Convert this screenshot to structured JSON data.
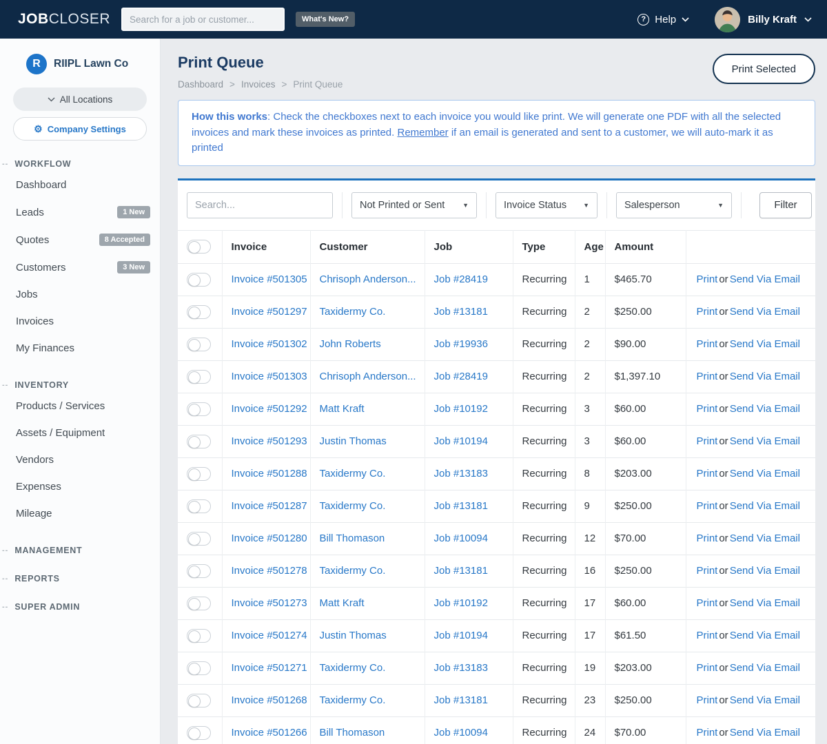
{
  "header": {
    "logo_bold": "JOB",
    "logo_light": "CLOSER",
    "search_placeholder": "Search for a job or customer...",
    "whats_new_label": "What's New?",
    "help_icon": "?",
    "help_label": "Help",
    "user_name": "Billy Kraft"
  },
  "sidebar": {
    "company_initial": "R",
    "company_name": "RIIPL Lawn Co",
    "locations_label": "All Locations",
    "settings_label": "Company Settings",
    "sections": [
      {
        "header": "WORKFLOW",
        "items": [
          {
            "label": "Dashboard"
          },
          {
            "label": "Leads",
            "badge": "1 New"
          },
          {
            "label": "Quotes",
            "badge": "8 Accepted"
          },
          {
            "label": "Customers",
            "badge": "3 New"
          },
          {
            "label": "Jobs"
          },
          {
            "label": "Invoices"
          },
          {
            "label": "My Finances"
          }
        ]
      },
      {
        "header": "INVENTORY",
        "items": [
          {
            "label": "Products / Services"
          },
          {
            "label": "Assets / Equipment"
          },
          {
            "label": "Vendors"
          },
          {
            "label": "Expenses"
          },
          {
            "label": "Mileage"
          }
        ]
      },
      {
        "header": "MANAGEMENT",
        "items": []
      },
      {
        "header": "REPORTS",
        "items": []
      },
      {
        "header": "SUPER ADMIN",
        "items": []
      }
    ]
  },
  "main": {
    "title": "Print Queue",
    "breadcrumb": [
      "Dashboard",
      "Invoices",
      "Print Queue"
    ],
    "breadcrumb_separator": ">",
    "print_selected_label": "Print Selected",
    "info": {
      "lead": "How this works",
      "body1": ": Check the checkboxes next to each invoice you would like print. We will generate one PDF with all the selected invoices and mark these invoices as printed. ",
      "remember": "Remember",
      "body2": " if an email is generated and sent to a customer, we will auto-mark it as printed"
    },
    "filters": {
      "search_placeholder": "Search...",
      "printed_filter_value": "Not Printed or Sent",
      "invoice_status_value": "Invoice Status",
      "salesperson_value": "Salesperson",
      "filter_button_label": "Filter"
    },
    "table": {
      "columns": [
        "Invoice",
        "Customer",
        "Job",
        "Type",
        "Age",
        "Amount"
      ],
      "actions": {
        "print": "Print",
        "or": "or",
        "email": "Send Via Email"
      },
      "rows": [
        {
          "invoice": "Invoice #501305",
          "customer": "Chrisoph Anderson...",
          "job": "Job #28419",
          "type": "Recurring",
          "age": "1",
          "amount": "$465.70"
        },
        {
          "invoice": "Invoice #501297",
          "customer": "Taxidermy Co.",
          "job": "Job #13181",
          "type": "Recurring",
          "age": "2",
          "amount": "$250.00"
        },
        {
          "invoice": "Invoice #501302",
          "customer": "John Roberts",
          "job": "Job #19936",
          "type": "Recurring",
          "age": "2",
          "amount": "$90.00"
        },
        {
          "invoice": "Invoice #501303",
          "customer": "Chrisoph Anderson...",
          "job": "Job #28419",
          "type": "Recurring",
          "age": "2",
          "amount": "$1,397.10"
        },
        {
          "invoice": "Invoice #501292",
          "customer": "Matt Kraft",
          "job": "Job #10192",
          "type": "Recurring",
          "age": "3",
          "amount": "$60.00"
        },
        {
          "invoice": "Invoice #501293",
          "customer": "Justin Thomas",
          "job": "Job #10194",
          "type": "Recurring",
          "age": "3",
          "amount": "$60.00"
        },
        {
          "invoice": "Invoice #501288",
          "customer": "Taxidermy Co.",
          "job": "Job #13183",
          "type": "Recurring",
          "age": "8",
          "amount": "$203.00"
        },
        {
          "invoice": "Invoice #501287",
          "customer": "Taxidermy Co.",
          "job": "Job #13181",
          "type": "Recurring",
          "age": "9",
          "amount": "$250.00"
        },
        {
          "invoice": "Invoice #501280",
          "customer": "Bill Thomason",
          "job": "Job #10094",
          "type": "Recurring",
          "age": "12",
          "amount": "$70.00"
        },
        {
          "invoice": "Invoice #501278",
          "customer": "Taxidermy Co.",
          "job": "Job #13181",
          "type": "Recurring",
          "age": "16",
          "amount": "$250.00"
        },
        {
          "invoice": "Invoice #501273",
          "customer": "Matt Kraft",
          "job": "Job #10192",
          "type": "Recurring",
          "age": "17",
          "amount": "$60.00"
        },
        {
          "invoice": "Invoice #501274",
          "customer": "Justin Thomas",
          "job": "Job #10194",
          "type": "Recurring",
          "age": "17",
          "amount": "$61.50"
        },
        {
          "invoice": "Invoice #501271",
          "customer": "Taxidermy Co.",
          "job": "Job #13183",
          "type": "Recurring",
          "age": "19",
          "amount": "$203.00"
        },
        {
          "invoice": "Invoice #501268",
          "customer": "Taxidermy Co.",
          "job": "Job #13181",
          "type": "Recurring",
          "age": "23",
          "amount": "$250.00"
        },
        {
          "invoice": "Invoice #501266",
          "customer": "Bill Thomason",
          "job": "Job #10094",
          "type": "Recurring",
          "age": "24",
          "amount": "$70.00"
        }
      ]
    }
  },
  "colors": {
    "header_bg": "#0e2946",
    "link_blue": "#2878c8",
    "card_accent": "#1d72bd",
    "info_text": "#4078d0",
    "navy_text": "#1b3b63"
  }
}
